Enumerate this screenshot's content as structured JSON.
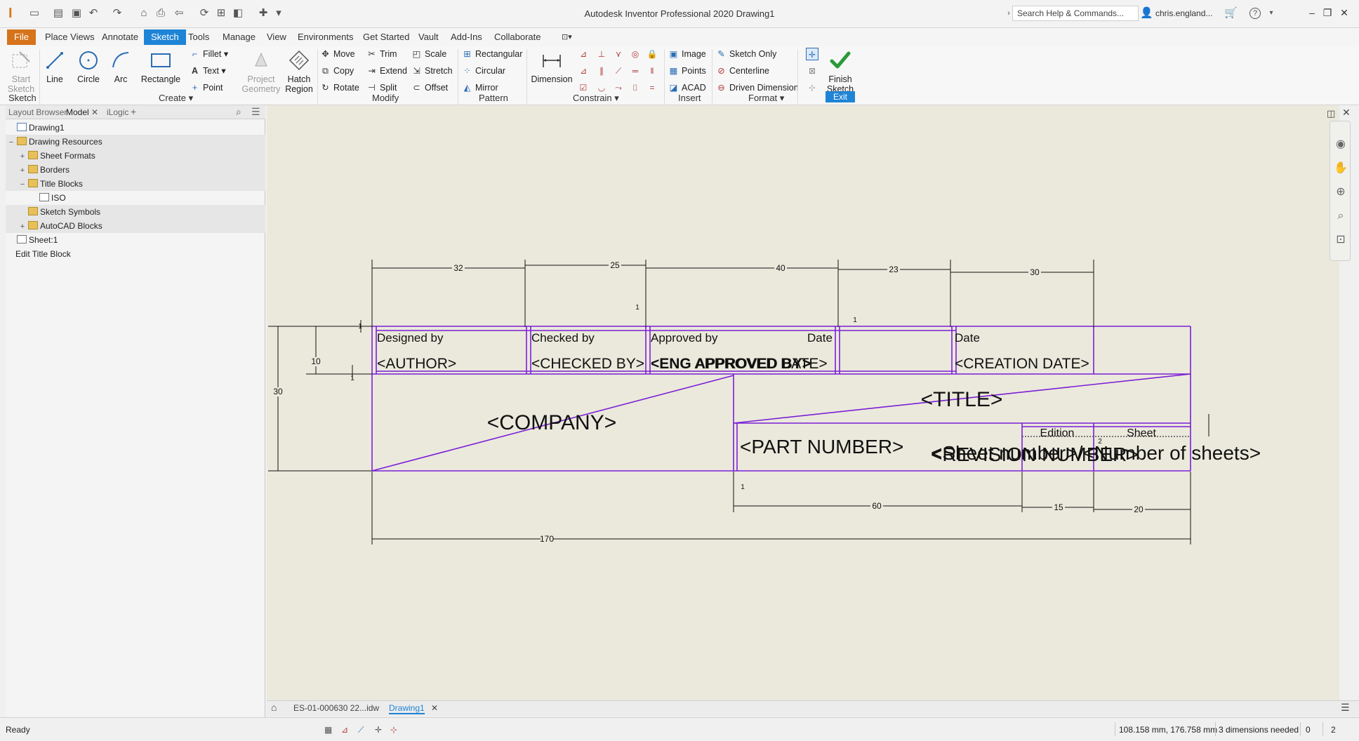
{
  "app": {
    "title": "Autodesk Inventor Professional 2020   Drawing1",
    "search_placeholder": "Search Help & Commands...",
    "user": "chris.england...",
    "help": "?"
  },
  "ribbon_tabs": [
    "File",
    "Place Views",
    "Annotate",
    "Sketch",
    "Tools",
    "Manage",
    "View",
    "Environments",
    "Get Started",
    "Vault",
    "Add-Ins",
    "Collaborate"
  ],
  "ribbon": {
    "sketch_panel": {
      "label": "Sketch",
      "start_sketch": "Start Sketch"
    },
    "create_panel": {
      "label": "Create",
      "line": "Line",
      "circle": "Circle",
      "arc": "Arc",
      "rectangle": "Rectangle",
      "fillet": "Fillet",
      "text": "Text",
      "point": "Point",
      "project_geometry": "Project Geometry",
      "hatch_region": "Hatch Region"
    },
    "modify_panel": {
      "label": "Modify",
      "move": "Move",
      "copy": "Copy",
      "rotate": "Rotate",
      "trim": "Trim",
      "extend": "Extend",
      "split": "Split",
      "scale": "Scale",
      "stretch": "Stretch",
      "offset": "Offset"
    },
    "pattern_panel": {
      "label": "Pattern",
      "rectangular": "Rectangular",
      "circular": "Circular",
      "mirror": "Mirror"
    },
    "constrain_panel": {
      "label": "Constrain",
      "dimension": "Dimension"
    },
    "insert_panel": {
      "label": "Insert",
      "image": "Image",
      "points": "Points",
      "acad": "ACAD"
    },
    "format_panel": {
      "label": "Format",
      "sketch_only": "Sketch Only",
      "centerline": "Centerline",
      "driven_dimension": "Driven Dimension"
    },
    "exit_panel": {
      "label": "Exit",
      "finish_sketch": "Finish Sketch"
    }
  },
  "browser": {
    "tabs": [
      "Layout Browser",
      "Model",
      "iLogic"
    ],
    "tree": [
      {
        "label": "Drawing1",
        "level": 0,
        "icon": "doc"
      },
      {
        "label": "Drawing Resources",
        "level": 0,
        "icon": "folder",
        "exp": "−",
        "shaded": true
      },
      {
        "label": "Sheet Formats",
        "level": 1,
        "icon": "folder",
        "exp": "+",
        "shaded": true
      },
      {
        "label": "Borders",
        "level": 1,
        "icon": "folder",
        "exp": "+",
        "shaded": true
      },
      {
        "label": "Title Blocks",
        "level": 1,
        "icon": "folder",
        "exp": "−",
        "shaded": true
      },
      {
        "label": "ISO",
        "level": 2,
        "icon": "sheet"
      },
      {
        "label": "Sketch Symbols",
        "level": 1,
        "icon": "folder",
        "shaded": true
      },
      {
        "label": "AutoCAD Blocks",
        "level": 1,
        "icon": "folder",
        "exp": "+",
        "shaded": true
      },
      {
        "label": "Sheet:1",
        "level": 0,
        "icon": "sheet"
      },
      {
        "label": "Edit Title Block",
        "level": 0,
        "icon": "none"
      }
    ]
  },
  "title_block": {
    "fields": {
      "designed_by": "Designed by",
      "author": "<AUTHOR>",
      "checked_by": "Checked by",
      "checked_by_value": "<CHECKED BY>",
      "approved_by": "Approved by",
      "eng_approved_by": "<ENG APPROVED BY>",
      "eng_approved_date": "<ENG APPROVED DATE>",
      "date_label_1": "Date",
      "date_label_2": "Date",
      "creation_date": "<CREATION DATE>",
      "company": "<COMPANY>",
      "title": "<TITLE>",
      "part_number": "<PART NUMBER>",
      "edition": "Edition",
      "sheet": "Sheet",
      "revision_number": "<REVISION NUMBER>",
      "sheet_number_overlap": "<Sheet number>/<Number of sheets>"
    },
    "dimensions": {
      "d32": "32",
      "d25": "25",
      "d40": "40",
      "d23": "23",
      "d30_top": "30",
      "d10": "10",
      "d30_left": "30",
      "d60": "60",
      "d15": "15",
      "d20": "20",
      "d170": "170",
      "one": "1",
      "two": "2"
    },
    "line_color": "#7b1fd6"
  },
  "doc_tabs": [
    "ES-01-000630 22...idw",
    "Drawing1"
  ],
  "status": {
    "ready": "Ready",
    "coordinates": "108.158 mm, 176.758 mm",
    "dimensions_needed": "3 dimensions needed",
    "count_a": "0",
    "count_b": "2"
  }
}
